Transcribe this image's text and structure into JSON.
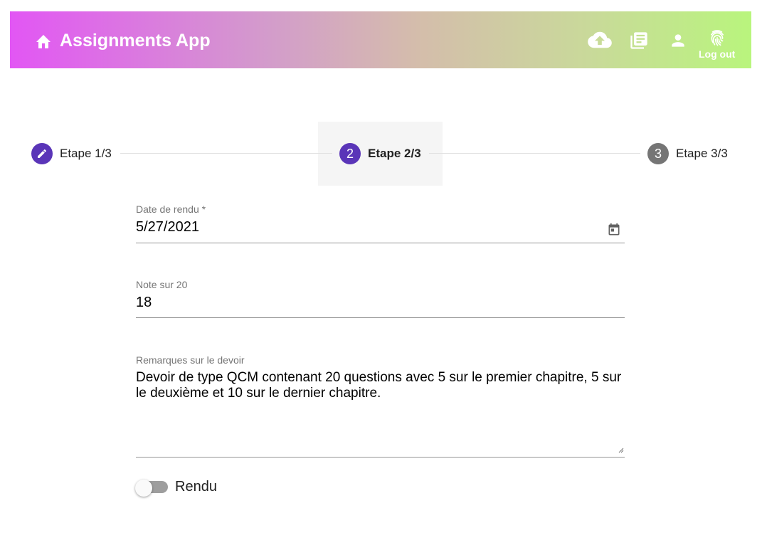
{
  "header": {
    "title": "Assignments App",
    "icons": [
      "home-icon",
      "cloud-upload-icon",
      "library-books-icon",
      "person-icon",
      "fingerprint-icon"
    ],
    "logout_label": "Log out"
  },
  "stepper": {
    "steps": [
      {
        "number": "1",
        "label": "Etape 1/3",
        "state": "completed",
        "icon": "edit-icon"
      },
      {
        "number": "2",
        "label": "Etape 2/3",
        "state": "active"
      },
      {
        "number": "3",
        "label": "Etape 3/3",
        "state": "pending"
      }
    ],
    "colors": {
      "active": "#5a35b8",
      "completed": "#5a35b8",
      "pending": "#757575"
    }
  },
  "form": {
    "due_date": {
      "label": "Date de rendu *",
      "value": "5/27/2021",
      "icon": "calendar-icon"
    },
    "grade": {
      "label": "Note sur 20",
      "value": "18"
    },
    "remarks": {
      "label": "Remarques sur le devoir",
      "value": "Devoir de type QCM contenant 20 questions avec 5 sur le premier chapitre, 5 sur le deuxième et 10 sur le dernier chapitre."
    },
    "submitted": {
      "label": "Rendu",
      "checked": false
    }
  }
}
